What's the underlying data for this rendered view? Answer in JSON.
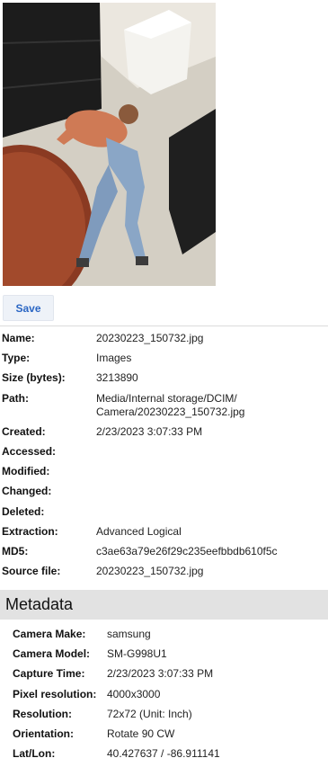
{
  "toolbar": {
    "save_label": "Save"
  },
  "properties": [
    {
      "key": "Name:",
      "value": "20230223_150732.jpg"
    },
    {
      "key": "Type:",
      "value": "Images"
    },
    {
      "key": "Size (bytes):",
      "value": "3213890"
    },
    {
      "key": "Path:",
      "value": "Media/Internal storage/DCIM/\nCamera/20230223_150732.jpg"
    },
    {
      "key": "Created:",
      "value": "2/23/2023 3:07:33 PM"
    },
    {
      "key": "Accessed:",
      "value": ""
    },
    {
      "key": "Modified:",
      "value": ""
    },
    {
      "key": "Changed:",
      "value": ""
    },
    {
      "key": "Deleted:",
      "value": ""
    },
    {
      "key": "Extraction:",
      "value": "Advanced Logical"
    },
    {
      "key": "MD5:",
      "value": "c3ae63a79e26f29c235eefbbdb610f5c"
    },
    {
      "key": "Source file:",
      "value": "20230223_150732.jpg"
    }
  ],
  "metadata": {
    "title": "Metadata",
    "rows": [
      {
        "key": "Camera Make:",
        "value": "samsung"
      },
      {
        "key": "Camera Model:",
        "value": "SM-G998U1"
      },
      {
        "key": "Capture Time:",
        "value": "2/23/2023 3:07:33 PM"
      },
      {
        "key": "Pixel resolution:",
        "value": "4000x3000"
      },
      {
        "key": "Resolution:",
        "value": "72x72 (Unit: Inch)"
      },
      {
        "key": "Orientation:",
        "value": "Rotate 90 CW"
      },
      {
        "key": "Lat/Lon:",
        "value": "40.427637 / -86.911141"
      }
    ]
  }
}
